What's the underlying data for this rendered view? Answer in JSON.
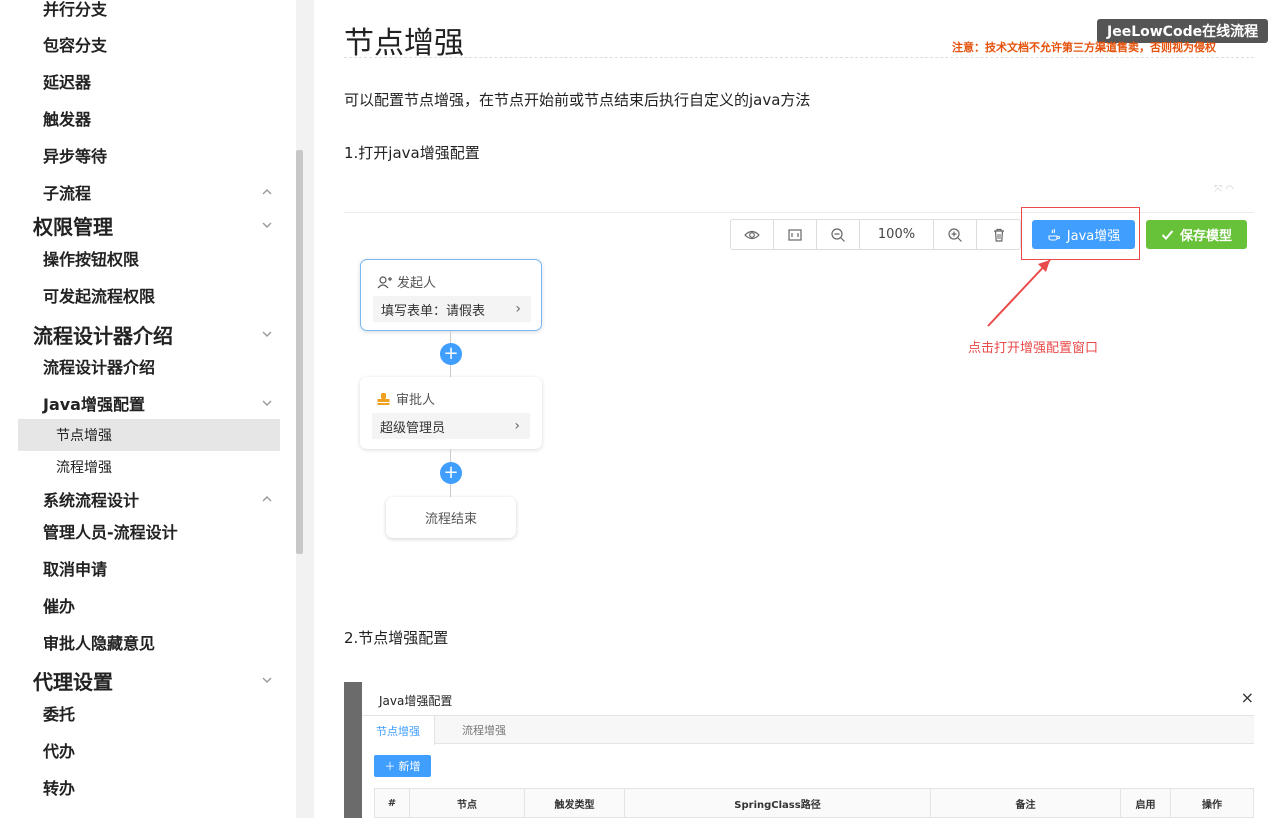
{
  "sidebar": {
    "items": [
      {
        "label": "并行分支",
        "level": 2
      },
      {
        "label": "包容分支",
        "level": 2
      },
      {
        "label": "延迟器",
        "level": 2
      },
      {
        "label": "触发器",
        "level": 2
      },
      {
        "label": "异步等待",
        "level": 2
      },
      {
        "label": "子流程",
        "level": 2
      },
      {
        "label": "权限管理",
        "level": 1
      },
      {
        "label": "操作按钮权限",
        "level": 2
      },
      {
        "label": "可发起流程权限",
        "level": 2
      },
      {
        "label": "流程设计器介绍",
        "level": 1
      },
      {
        "label": "流程设计器介绍",
        "level": 2
      },
      {
        "label": "Java增强配置",
        "level": 2
      },
      {
        "label": "节点增强",
        "level": 3,
        "active": true
      },
      {
        "label": "流程增强",
        "level": 3
      },
      {
        "label": "系统流程设计",
        "level": 2
      },
      {
        "label": "管理人员-流程设计",
        "level": 2
      },
      {
        "label": "取消申请",
        "level": 2
      },
      {
        "label": "催办",
        "level": 2
      },
      {
        "label": "审批人隐藏意见",
        "level": 2
      },
      {
        "label": "代理设置",
        "level": 1
      },
      {
        "label": "委托",
        "level": 2
      },
      {
        "label": "代办",
        "level": 2
      },
      {
        "label": "转办",
        "level": 2
      }
    ]
  },
  "main": {
    "title": "节点增强",
    "brand_badge": "JeeLowCode在线流程",
    "notice": "注意：技术文档不允许第三方渠道售卖，否则视为侵权",
    "intro": "可以配置节点增强，在节点开始前或节点结束后执行自定义的java方法",
    "step1": "1.打开java增强配置",
    "step2": "2.节点增强配置"
  },
  "designer": {
    "zoom": "100%",
    "java_button": "Java增强",
    "save_button": "保存模型",
    "annotation": "点击打开增强配置窗口",
    "nodes": {
      "initiator_title": "发起人",
      "initiator_field": "填写表单：请假表",
      "approver_title": "审批人",
      "approver_field": "超级管理员",
      "end": "流程结束"
    }
  },
  "dialog": {
    "title": "Java增强配置",
    "close": "×",
    "tabs": [
      "节点增强",
      "流程增强"
    ],
    "add_button": "新增",
    "columns": [
      "#",
      "节点",
      "触发类型",
      "SpringClass路径",
      "备注",
      "启用",
      "操作"
    ]
  },
  "colors": {
    "primary": "#409eff",
    "success": "#67c23a",
    "annotation": "#e94a4a",
    "notice": "#e4520c"
  }
}
